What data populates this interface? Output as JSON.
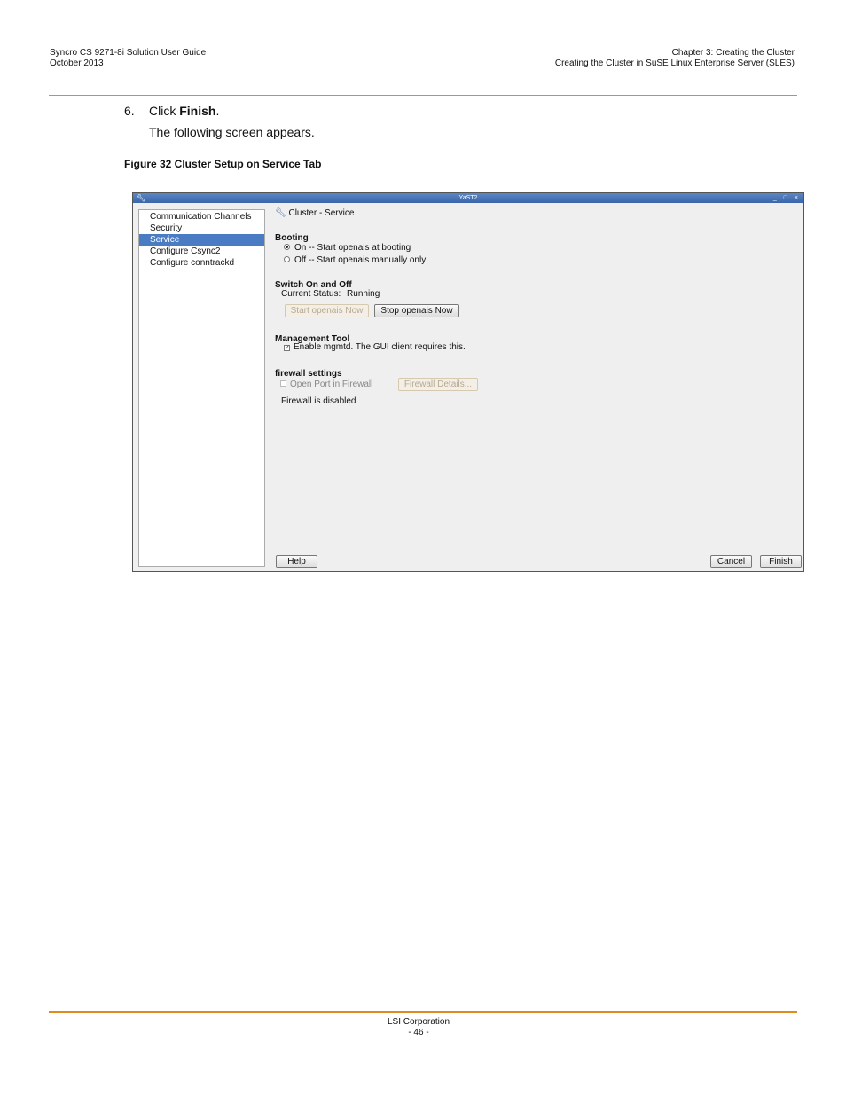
{
  "header": {
    "left_line1": "Syncro CS 9271-8i Solution User Guide",
    "left_line2": "October 2013",
    "right_line1": "Chapter 3: Creating the Cluster",
    "right_line2": "Creating the Cluster in SuSE Linux Enterprise Server (SLES)"
  },
  "step": {
    "number": "6.",
    "click": "Click",
    "finish": "Finish",
    "period": ".",
    "following": "The following screen appears."
  },
  "figure": {
    "caption": "Figure 32  Cluster Setup on Service Tab"
  },
  "window": {
    "title": "YaST2",
    "sidebar": [
      "Communication Channels",
      "Security",
      "Service",
      "Configure Csync2",
      "Configure conntrackd"
    ],
    "heading": "Cluster - Service",
    "booting": {
      "label": "Booting",
      "on": "On -- Start openais at booting",
      "off": "Off -- Start openais manually only"
    },
    "switch": {
      "label": "Switch On and Off",
      "status_label": "Current Status:",
      "status_value": "Running",
      "start_button": "Start openais Now",
      "stop_button": "Stop openais Now"
    },
    "management": {
      "label": "Management Tool",
      "enable": "Enable mgmtd. The GUI client requires this."
    },
    "firewall": {
      "label": "firewall settings",
      "open_port": "Open Port in Firewall",
      "details_button": "Firewall Details...",
      "status": "Firewall is disabled"
    },
    "buttons": {
      "help": "Help",
      "cancel": "Cancel",
      "finish": "Finish"
    },
    "colors": {
      "titlebar": "#3a66aa",
      "selection": "#4a7cc4"
    }
  },
  "footer": {
    "company": "LSI Corporation",
    "page": "- 46 -"
  }
}
